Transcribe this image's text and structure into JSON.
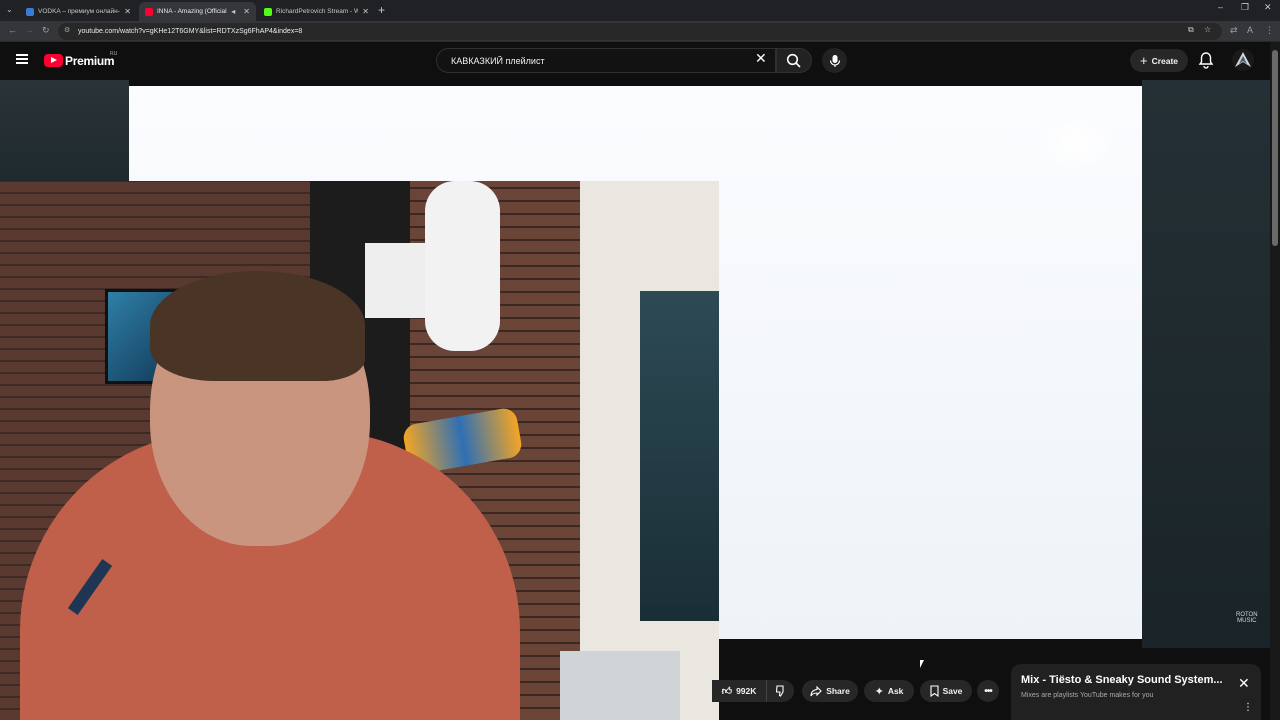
{
  "browser": {
    "tabs": [
      {
        "title": "VODKA – премиум онлайн-ка",
        "favicon_color": "#3a7bd5"
      },
      {
        "title": "INNA - Amazing (Official V",
        "favicon_color": "#ff0033"
      },
      {
        "title": "RichardPetrovich Stream - Wat",
        "favicon_color": "#53fc18"
      }
    ],
    "url": "youtube.com/watch?v=gKHe12T6GMY&list=RDTXzSg6FhAP4&index=8"
  },
  "masthead": {
    "brand": "Premium",
    "region": "RU",
    "search_value": "КАВКАЗКИЙ плейлист",
    "create_label": "Create"
  },
  "video": {
    "watermark_line1": "ROTON",
    "watermark_line2": "MUSIC"
  },
  "actions": {
    "likes": "992K",
    "share_label": "Share",
    "ask_label": "Ask",
    "save_label": "Save"
  },
  "mix": {
    "title": "Mix - Tiësto & Sneaky Sound System...",
    "subtitle": "Mixes are playlists YouTube makes for you"
  },
  "colors": {
    "accent": "#ff0033",
    "background": "#0f0f0f",
    "chip": "#272727"
  }
}
